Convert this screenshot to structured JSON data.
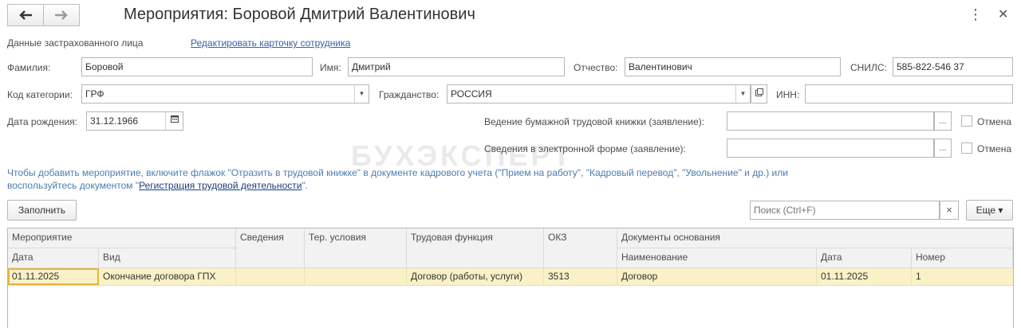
{
  "header": {
    "title": "Мероприятия: Боровой Дмитрий Валентинович",
    "back_icon": "arrow-left-icon",
    "forward_icon": "arrow-right-icon",
    "more_glyph": "⋮",
    "close_glyph": "✕"
  },
  "insured": {
    "section_label": "Данные застрахованного лица",
    "edit_link": "Редактировать карточку сотрудника"
  },
  "fields": {
    "surname_label": "Фамилия:",
    "surname_value": "Боровой",
    "name_label": "Имя:",
    "name_value": "Дмитрий",
    "patronymic_label": "Отчество:",
    "patronymic_value": "Валентинович",
    "snils_label": "СНИЛС:",
    "snils_value": "585-822-546 37",
    "category_label": "Код категории:",
    "category_value": "ГРФ",
    "citizenship_label": "Гражданство:",
    "citizenship_value": "РОССИЯ",
    "inn_label": "ИНН:",
    "inn_value": "",
    "birth_label": "Дата рождения:",
    "birth_value": "31.12.1966",
    "paper_book_label": "Ведение бумажной трудовой книжки (заявление):",
    "paper_book_value": "",
    "electronic_label": "Сведения в электронной форме (заявление):",
    "electronic_value": "",
    "cancel_label_1": "Отмена",
    "cancel_label_2": "Отмена",
    "ellipsis": "..."
  },
  "info": {
    "text_before": "Чтобы добавить мероприятие, включите флажок \"Отразить в трудовой книжке\" в документе кадрового учета (\"Прием на работу\", \"Кадровый перевод\", \"Увольнение\" и др.) или воспользуйтесь документом \"",
    "link": "Регистрация трудовой деятельности",
    "text_after": "\"."
  },
  "watermark": "БУХЭКСПЕРТ",
  "toolbar": {
    "fill_button": "Заполнить",
    "search_placeholder": "Поиск (Ctrl+F)",
    "clear_glyph": "×",
    "more_button": "Еще ▾"
  },
  "table": {
    "group_event": "Мероприятие",
    "col_date": "Дата",
    "col_kind": "Вид",
    "col_info": "Сведения",
    "col_terr": "Тер. условия",
    "col_function": "Трудовая функция",
    "col_okz": "ОКЗ",
    "group_docs": "Документы основания",
    "col_doc_name": "Наименование",
    "col_doc_date": "Дата",
    "col_doc_num": "Номер",
    "rows": [
      {
        "date": "01.11.2025",
        "kind": "Окончание договора ГПХ",
        "info": "",
        "terr": "",
        "function": "Договор (работы, услуги)",
        "okz": "3513",
        "doc_name": "Договор",
        "doc_date": "01.11.2025",
        "doc_num": "1"
      }
    ]
  },
  "colors": {
    "accent_link": "#3a5fa8",
    "info_text": "#4a7db0",
    "selected_row": "#fbf1c7",
    "focus_border": "#e8b53b"
  }
}
